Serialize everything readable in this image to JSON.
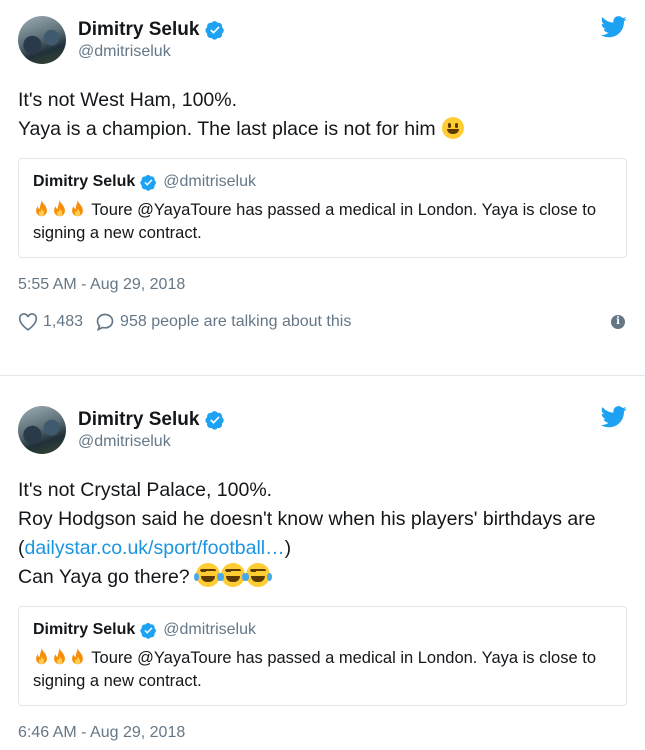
{
  "tweets": [
    {
      "author": {
        "name": "Dimitry Seluk",
        "handle": "@dmitriseluk"
      },
      "lines": [
        "It's not West Ham, 100%.",
        "Yaya is a champion. The last place is not for him"
      ],
      "quote": {
        "name": "Dimitry Seluk",
        "handle": "@dmitriseluk",
        "text": " Toure @YayaToure has passed a medical in London. Yaya is close to signing a new contract."
      },
      "timestamp": "5:55 AM - Aug 29, 2018",
      "likes": "1,483",
      "talking": "958 people are talking about this"
    },
    {
      "author": {
        "name": "Dimitry Seluk",
        "handle": "@dmitriseluk"
      },
      "line1": "It's not Crystal Palace, 100%.",
      "line2": "Roy Hodgson said he doesn't know when his players' birthdays are (",
      "link": "dailystar.co.uk/sport/football…",
      "line2_end": ")",
      "line3": "Can Yaya go there? ",
      "quote": {
        "name": "Dimitry Seluk",
        "handle": "@dmitriseluk",
        "text": " Toure @YayaToure has passed a medical in London. Yaya is close to signing a new contract."
      },
      "timestamp": "6:46 AM - Aug 29, 2018"
    }
  ],
  "icons": {
    "verified": "verified-badge-icon",
    "twitter": "twitter-bird-icon",
    "like": "heart-icon",
    "reply": "speech-bubble-icon",
    "info": "info-icon",
    "fire": "fire-emoji-icon",
    "smile": "smile-emoji-icon",
    "laugh": "tears-of-joy-emoji-icon"
  },
  "colors": {
    "accent": "#1da1f2",
    "link": "#1b95e0",
    "secondary": "#657786",
    "border": "#e1e8ed"
  }
}
